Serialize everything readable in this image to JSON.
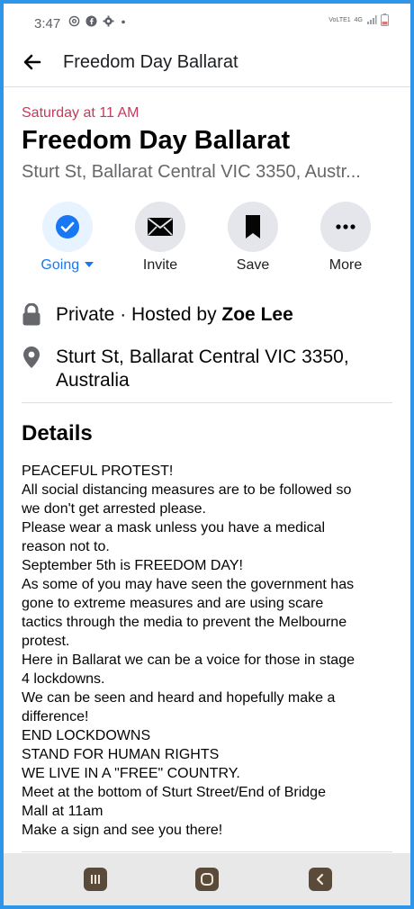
{
  "status_bar": {
    "time": "3:47",
    "network_label": "VoLTE1",
    "data_label": "4G"
  },
  "app_bar": {
    "title": "Freedom Day Ballarat"
  },
  "event": {
    "date": "Saturday at 11 AM",
    "title": "Freedom Day Ballarat",
    "location_short": "Sturt St, Ballarat Central VIC 3350, Austr..."
  },
  "actions": [
    {
      "label": "Going",
      "icon": "check-circle-icon"
    },
    {
      "label": "Invite",
      "icon": "envelope-icon"
    },
    {
      "label": "Save",
      "icon": "bookmark-icon"
    },
    {
      "label": "More",
      "icon": "more-icon"
    }
  ],
  "info": {
    "privacy_prefix": "Private · Hosted by ",
    "host": "Zoe Lee",
    "address_line1": "Sturt St, Ballarat Central VIC 3350,",
    "address_line2": "Australia"
  },
  "details": {
    "heading": "Details",
    "lines": [
      "PEACEFUL PROTEST!",
      "All social distancing measures are to be followed so",
      "we don't get arrested please.",
      "Please wear a mask unless you have a medical",
      "reason not to.",
      "September 5th is FREEDOM DAY!",
      "As some of you may have seen the government has",
      "gone to extreme measures and are using scare",
      "tactics through the media to prevent the Melbourne",
      "protest.",
      "Here in Ballarat we can be a voice for those in stage",
      "4 lockdowns.",
      "We can be seen and heard and hopefully make a",
      "difference!",
      "END LOCKDOWNS",
      "STAND FOR HUMAN RIGHTS",
      "WE LIVE IN A \"FREE\" COUNTRY.",
      "Meet at the bottom of Sturt Street/End of Bridge",
      "Mall at 11am",
      "Make a sign and see you there!"
    ]
  },
  "colors": {
    "accent": "#1877f2",
    "date": "#c8385a",
    "frame": "#2f95e8"
  }
}
